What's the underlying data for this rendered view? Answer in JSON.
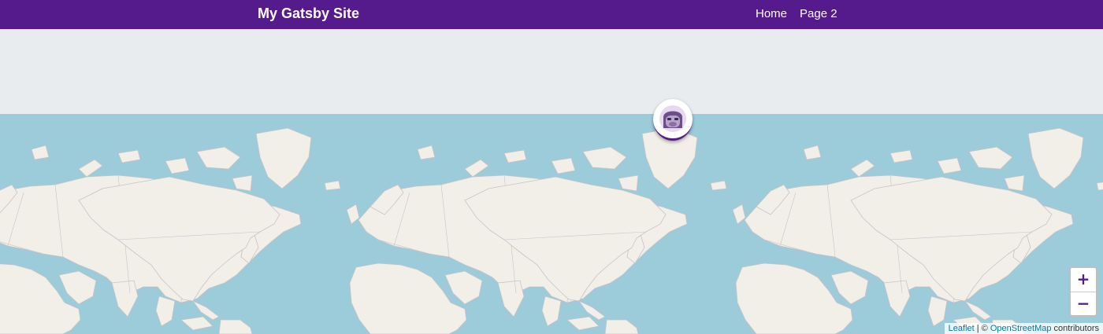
{
  "header": {
    "site_title": "My Gatsby Site",
    "nav": [
      {
        "label": "Home"
      },
      {
        "label": "Page 2"
      }
    ]
  },
  "map": {
    "marker": {
      "icon": "gorilla-avatar-icon"
    },
    "zoom": {
      "in_label": "+",
      "out_label": "−"
    },
    "attribution": {
      "leaflet": "Leaflet",
      "separator": " | © ",
      "osm": "OpenStreetMap",
      "suffix": " contributors"
    },
    "colors": {
      "ocean": "#9ccbda",
      "land": "#f2efe9",
      "border": "#c8c2c8",
      "background": "#e8ecef"
    }
  },
  "theme": {
    "brand_color": "#551a8b"
  }
}
